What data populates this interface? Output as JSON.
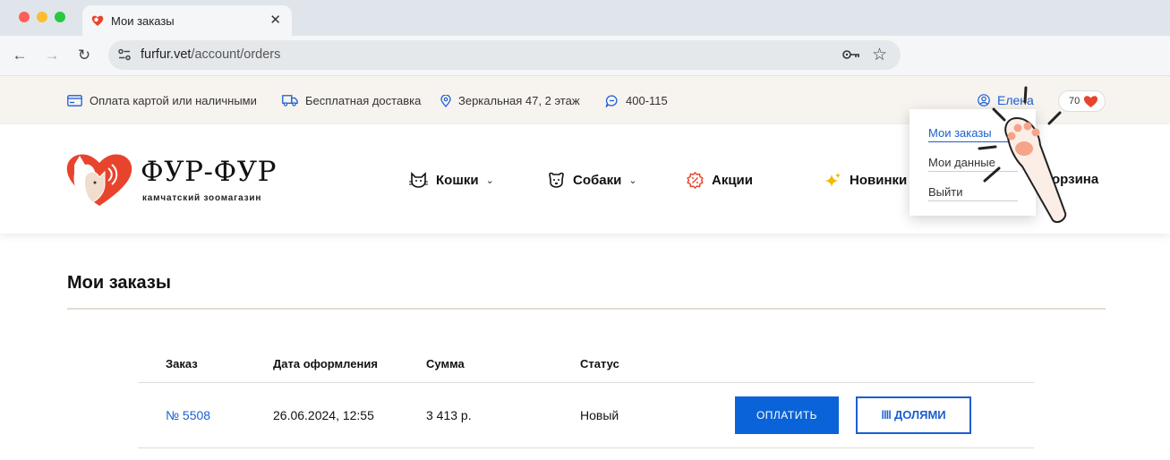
{
  "browser": {
    "tab_title": "Мои заказы",
    "url_domain": "furfur.vet",
    "url_path": "/account/orders"
  },
  "topbar": {
    "payment": "Оплата картой или наличными",
    "delivery": "Бесплатная доставка",
    "address": "Зеркальная 47, 2 этаж",
    "phone": "400-115",
    "user": "Елена",
    "favorites_count": "70"
  },
  "header": {
    "logo_title": "ФУР-ФУР",
    "logo_subtitle": "камчатский зоомагазин",
    "menu": {
      "cats": "Кошки",
      "dogs": "Собаки",
      "sales": "Акции",
      "new": "Новинки",
      "cart": "орзина"
    }
  },
  "account_menu": {
    "orders": "Мои заказы",
    "profile": "Мои данные",
    "logout": "Выйти"
  },
  "main": {
    "title": "Мои заказы",
    "columns": {
      "order": "Заказ",
      "date": "Дата оформления",
      "sum": "Сумма",
      "status": "Статус"
    },
    "orders": [
      {
        "number": "№ 5508",
        "date": "26.06.2024, 12:55",
        "sum": "3 413 р.",
        "status": "Новый",
        "pay_label": "ОПЛАТИТЬ",
        "parts_label": "ДОЛЯМИ"
      }
    ]
  },
  "colors": {
    "accent": "#0a63d8",
    "brand_red": "#e8442d",
    "topbar_bg": "#f7f3ef"
  }
}
